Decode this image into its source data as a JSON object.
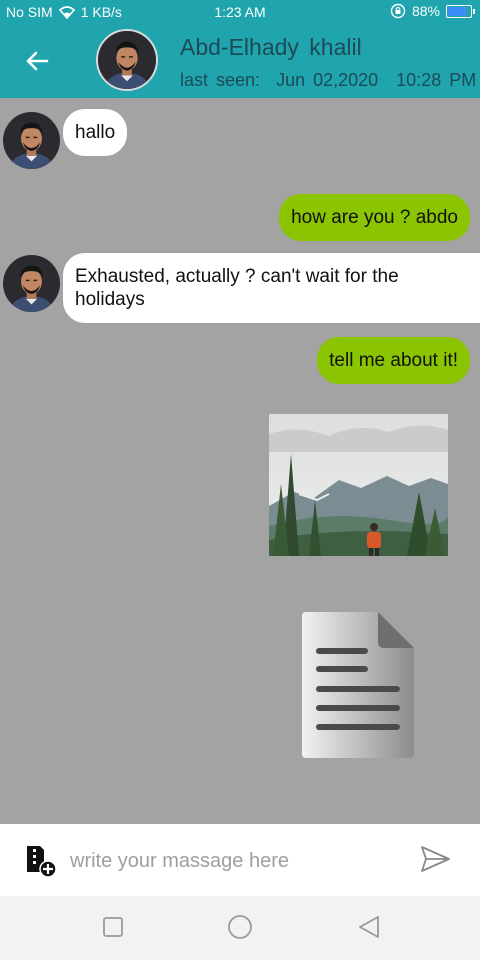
{
  "status_bar": {
    "carrier": "No SIM",
    "speed": "1 KB/s",
    "time": "1:23 AM",
    "battery": "88%",
    "battery_level": 0.88
  },
  "header": {
    "contact_name": "Abd-Elhady  khalil",
    "last_seen_label": "last seen:",
    "last_seen_date": "Jun 02,2020",
    "last_seen_time": "10:28 PM",
    "icons": {
      "back": "arrow-left-icon",
      "avatar": "avatar"
    }
  },
  "messages": [
    {
      "direction": "incoming",
      "text": "hallo"
    },
    {
      "direction": "outgoing",
      "text": "how are you ? abdo"
    },
    {
      "direction": "incoming",
      "text": "Exhausted, actually ? can't wait for the holidays"
    },
    {
      "direction": "outgoing",
      "text": "tell me about it!"
    },
    {
      "direction": "outgoing",
      "type": "image",
      "subject": "hiker-mountain-photo"
    },
    {
      "direction": "outgoing",
      "type": "file",
      "icon": "document-icon"
    }
  ],
  "composer": {
    "placeholder": "write your massage here",
    "attach_icon": "attach-file-icon",
    "send_icon": "send-icon"
  },
  "nav_bar": {
    "icons": [
      "recent-apps-icon",
      "home-icon",
      "back-icon"
    ]
  },
  "colors": {
    "header": "#20a4ae",
    "chat_background": "#a3a3a3",
    "incoming_bubble": "#ffffff",
    "outgoing_bubble": "#8bc400",
    "header_text": "#1c4b55"
  }
}
